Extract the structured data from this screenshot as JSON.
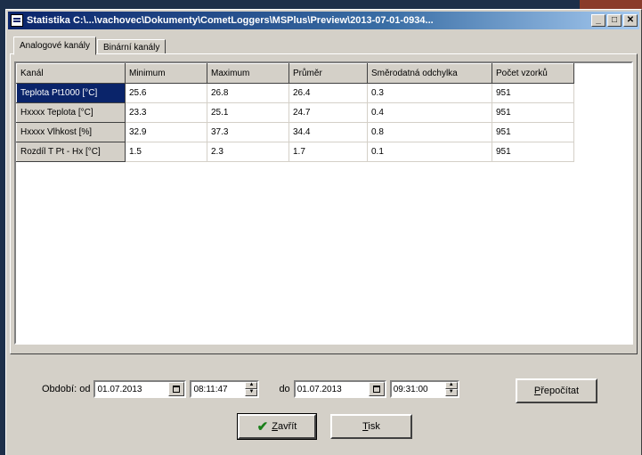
{
  "window": {
    "title": "Statistika C:\\...\\vachovec\\Dokumenty\\CometLoggers\\MSPlus\\Preview\\2013-07-01-0934..."
  },
  "tabs": [
    {
      "label": "Analogové kanály"
    },
    {
      "label": "Binární kanály"
    }
  ],
  "table": {
    "headers": [
      "Kanál",
      "Minimum",
      "Maximum",
      "Průměr",
      "Směrodatná odchylka",
      "Počet vzorků"
    ],
    "rows": [
      {
        "channel": "Teplota Pt1000 [°C]",
        "min": "25.6",
        "max": "26.8",
        "avg": "26.4",
        "std": "0.3",
        "count": "951"
      },
      {
        "channel": "Hxxxx Teplota [°C]",
        "min": "23.3",
        "max": "25.1",
        "avg": "24.7",
        "std": "0.4",
        "count": "951"
      },
      {
        "channel": "Hxxxx Vlhkost [%]",
        "min": "32.9",
        "max": "37.3",
        "avg": "34.4",
        "std": "0.8",
        "count": "951"
      },
      {
        "channel": "Rozdíl T Pt - Hx [°C]",
        "min": "1.5",
        "max": "2.3",
        "avg": "1.7",
        "std": "0.1",
        "count": "951"
      }
    ]
  },
  "period": {
    "label_from": "Období: od",
    "from_date": "01.07.2013",
    "from_time": "08:11:47",
    "label_to": "do",
    "to_date": "01.07.2013",
    "to_time": "09:31:00"
  },
  "buttons": {
    "recalc": "Přepočítat",
    "close": "Zavřít",
    "print": "Tisk"
  },
  "colors": {
    "selection": "#0a246a",
    "face": "#d4d0c8",
    "check": "#1a7f1a"
  }
}
